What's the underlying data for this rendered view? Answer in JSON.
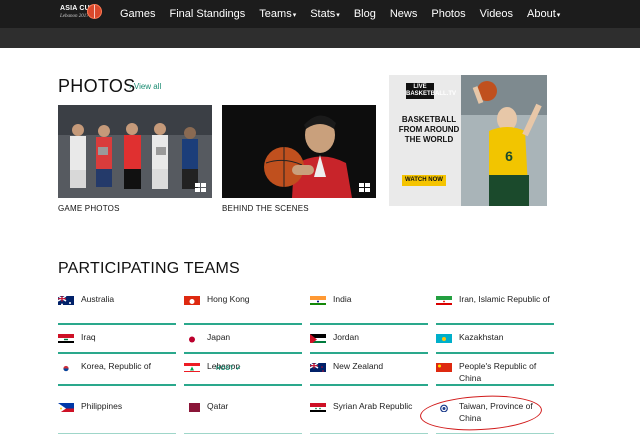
{
  "logo": {
    "text": "ASIA CUP",
    "sub": "Lebanon 2017"
  },
  "nav": [
    {
      "label": "Games",
      "caret": ""
    },
    {
      "label": "Final Standings",
      "caret": ""
    },
    {
      "label": "Teams",
      "caret": "▾"
    },
    {
      "label": "Stats",
      "caret": "▾"
    },
    {
      "label": "Blog",
      "caret": ""
    },
    {
      "label": "News",
      "caret": ""
    },
    {
      "label": "Photos",
      "caret": ""
    },
    {
      "label": "Videos",
      "caret": ""
    },
    {
      "label": "About",
      "caret": "▾"
    }
  ],
  "photos": {
    "title": "PHOTOS",
    "view_all": "› View all",
    "items": [
      {
        "caption": "GAME PHOTOS"
      },
      {
        "caption": "BEHIND THE SCENES"
      }
    ]
  },
  "ad": {
    "live_label": "LIVE\nBASKETBALL.TV",
    "headline": "BASKETBALL FROM AROUND THE WORLD",
    "button": "WATCH NOW",
    "jersey_number": "6"
  },
  "teams": {
    "title": "PARTICIPATING TEAMS",
    "host_label": "HOST ✔",
    "list": [
      {
        "name": "Australia"
      },
      {
        "name": "Hong Kong"
      },
      {
        "name": "India"
      },
      {
        "name": "Iran, Islamic Republic of"
      },
      {
        "name": "Iraq"
      },
      {
        "name": "Japan"
      },
      {
        "name": "Jordan"
      },
      {
        "name": "Kazakhstan"
      },
      {
        "name": "Korea, Republic of"
      },
      {
        "name": "Lebanon"
      },
      {
        "name": "New Zealand"
      },
      {
        "name": "People's Republic of China"
      },
      {
        "name": "Philippines"
      },
      {
        "name": "Qatar"
      },
      {
        "name": "Syrian Arab Republic"
      },
      {
        "name": "Taiwan, Province of China"
      }
    ]
  },
  "colors": {
    "accent": "#2aa88c",
    "nav_bg": "#1c1c1c",
    "annotation": "#d11a1a"
  }
}
